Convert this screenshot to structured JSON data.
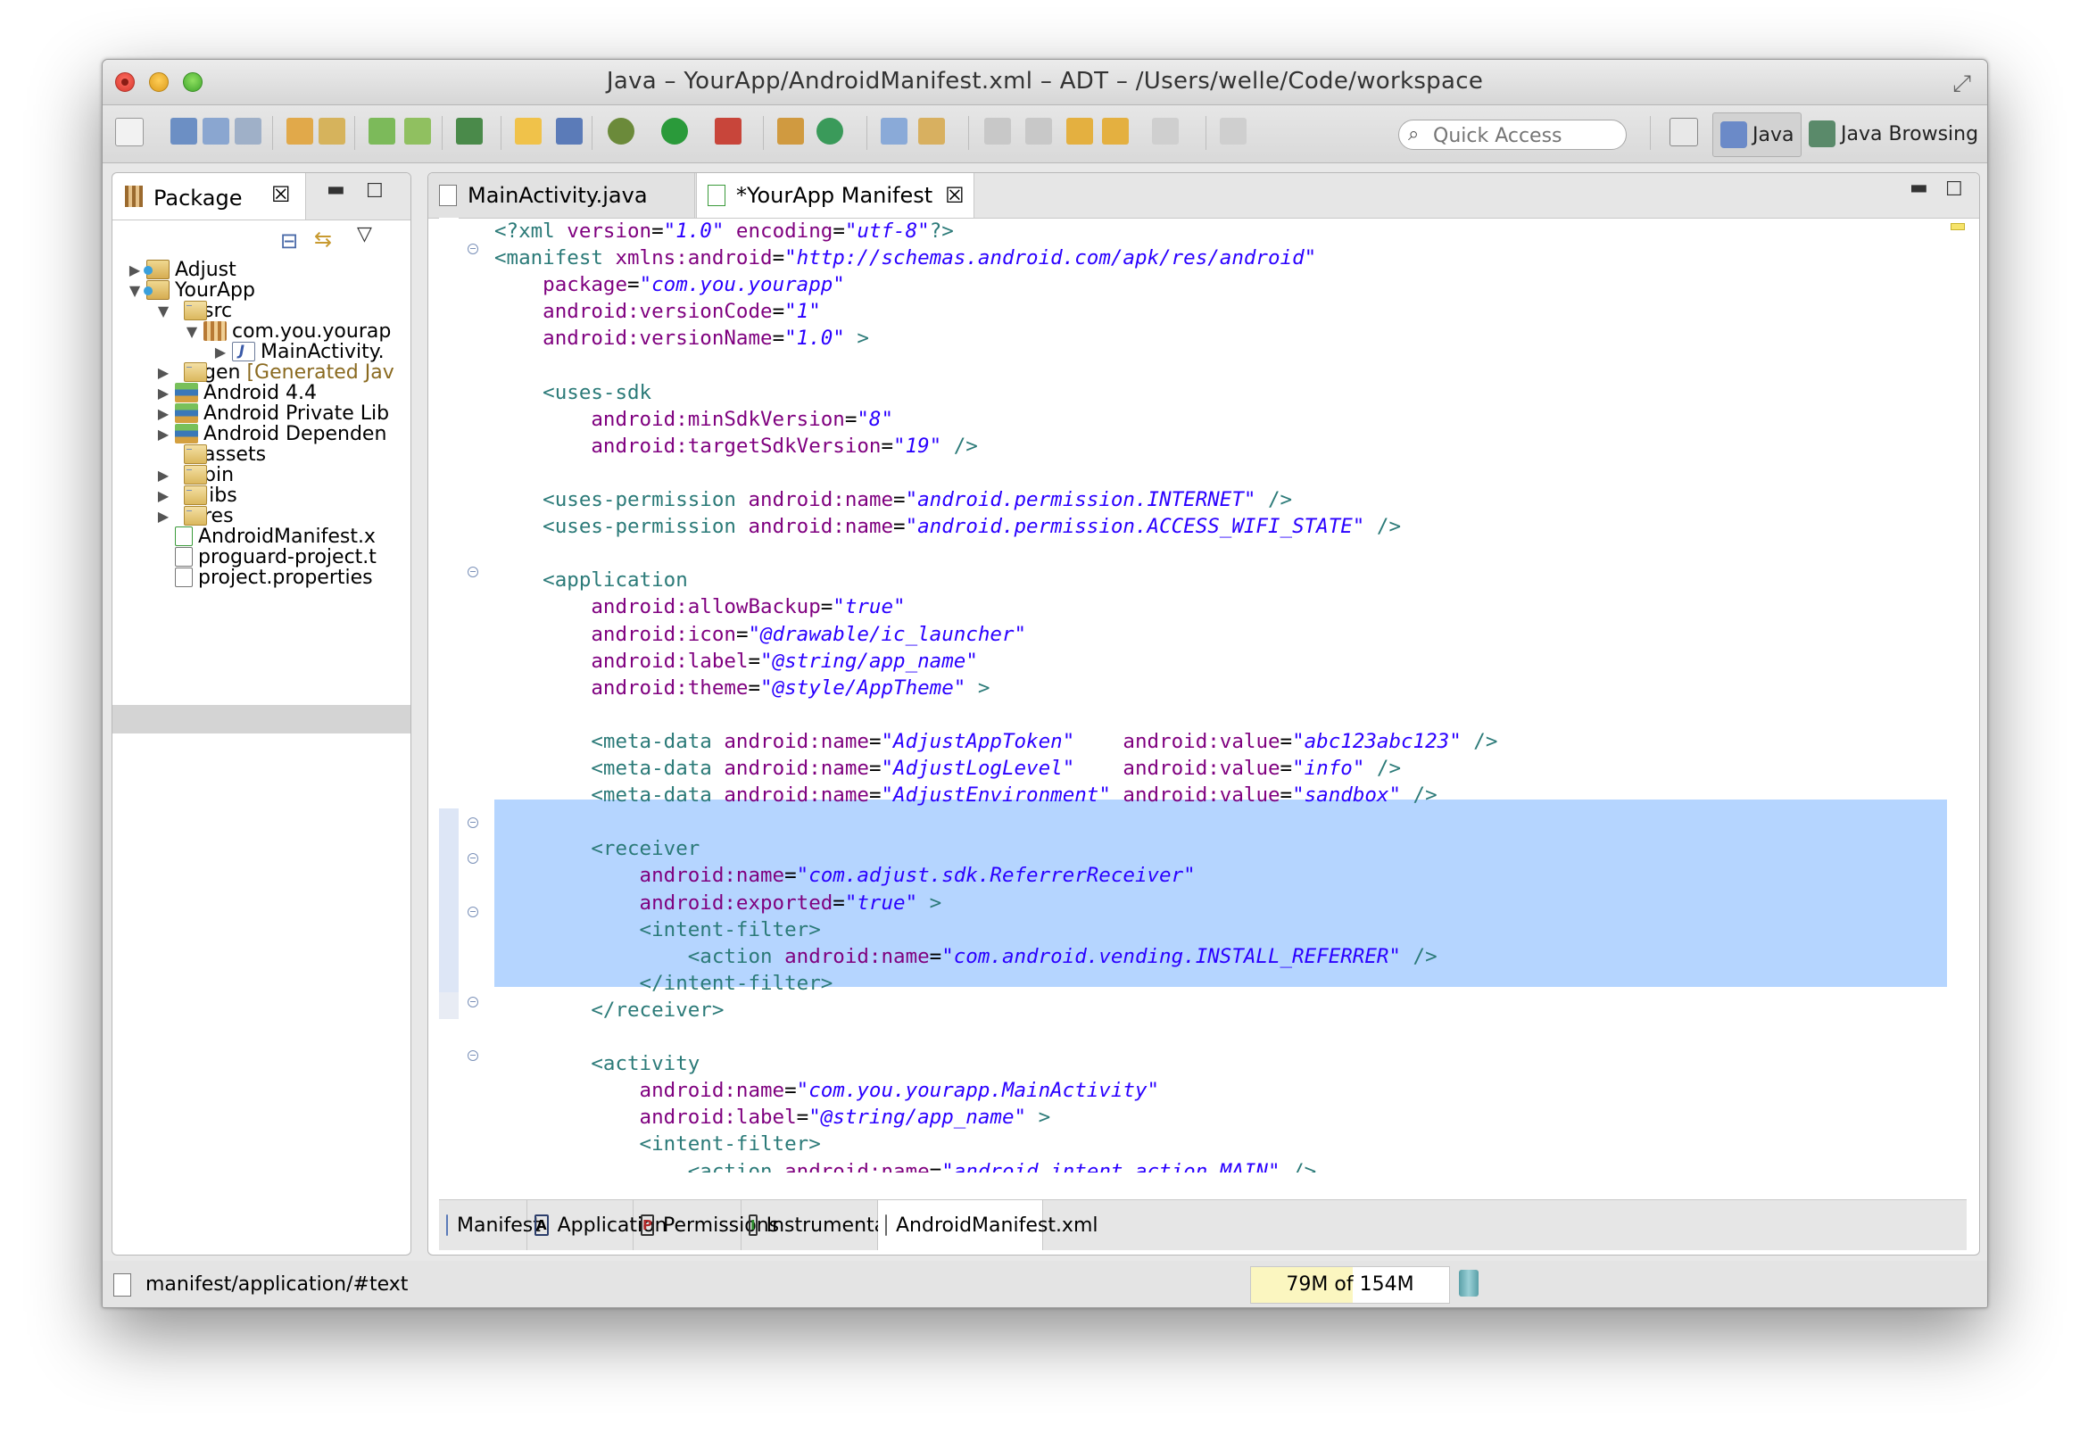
{
  "window": {
    "title": "Java – YourApp/AndroidManifest.xml – ADT – /Users/welle/Code/workspace"
  },
  "toolbar": {
    "quick_access_placeholder": "Quick Access",
    "perspectives": [
      {
        "label": "Java",
        "icon": "java-perspective-icon"
      },
      {
        "label": "Java Browsing",
        "icon": "java-browsing-perspective-icon"
      }
    ]
  },
  "package_explorer": {
    "tab_label": "Package",
    "tree": [
      {
        "label": "Adjust",
        "level": 0,
        "expanded": false,
        "icon": "project-icon"
      },
      {
        "label": "YourApp",
        "level": 0,
        "expanded": true,
        "icon": "project-icon"
      },
      {
        "label": "src",
        "level": 1,
        "expanded": true,
        "icon": "source-folder-icon"
      },
      {
        "label": "com.you.yourap",
        "level": 2,
        "expanded": true,
        "icon": "package-icon"
      },
      {
        "label": "MainActivity.",
        "level": 3,
        "expanded": false,
        "icon": "java-file-icon"
      },
      {
        "label": "gen",
        "suffix": "[Generated Jav",
        "level": 1,
        "expanded": false,
        "icon": "source-folder-icon"
      },
      {
        "label": "Android 4.4",
        "level": 1,
        "expanded": false,
        "icon": "library-icon"
      },
      {
        "label": "Android Private Lib",
        "level": 1,
        "expanded": false,
        "icon": "library-icon"
      },
      {
        "label": "Android Dependen",
        "level": 1,
        "expanded": false,
        "icon": "library-icon"
      },
      {
        "label": "assets",
        "level": 1,
        "expanded": null,
        "icon": "folder-icon"
      },
      {
        "label": "bin",
        "level": 1,
        "expanded": false,
        "icon": "folder-icon"
      },
      {
        "label": "libs",
        "level": 1,
        "expanded": false,
        "icon": "folder-icon"
      },
      {
        "label": "res",
        "level": 1,
        "expanded": false,
        "icon": "folder-icon"
      },
      {
        "label": "AndroidManifest.x",
        "level": 1,
        "expanded": null,
        "icon": "manifest-file-icon",
        "selected": true
      },
      {
        "label": "proguard-project.t",
        "level": 1,
        "expanded": null,
        "icon": "text-file-icon"
      },
      {
        "label": "project.properties",
        "level": 1,
        "expanded": null,
        "icon": "text-file-icon"
      }
    ]
  },
  "editor": {
    "tabs": [
      {
        "label": "MainActivity.java",
        "icon": "java-file-icon",
        "active": false
      },
      {
        "label": "*YourApp Manifest",
        "icon": "manifest-file-icon",
        "active": true
      }
    ],
    "code_lines": [
      [
        [
          "pi",
          "<?xml "
        ],
        [
          "attr",
          "version"
        ],
        [
          "punc",
          "="
        ],
        [
          "val",
          "\"1.0\""
        ],
        [
          "attr",
          " encoding"
        ],
        [
          "punc",
          "="
        ],
        [
          "val",
          "\"utf-8\""
        ],
        [
          "pi",
          "?>"
        ]
      ],
      [
        [
          "tag",
          "<manifest "
        ],
        [
          "attr",
          "xmlns:android"
        ],
        [
          "punc",
          "="
        ],
        [
          "val",
          "\"http://schemas.android.com/apk/res/android\""
        ]
      ],
      [
        [
          "attr",
          "    package"
        ],
        [
          "punc",
          "="
        ],
        [
          "val",
          "\"com.you.yourapp\""
        ]
      ],
      [
        [
          "attr",
          "    android:versionCode"
        ],
        [
          "punc",
          "="
        ],
        [
          "val",
          "\"1\""
        ]
      ],
      [
        [
          "attr",
          "    android:versionName"
        ],
        [
          "punc",
          "="
        ],
        [
          "val",
          "\"1.0\""
        ],
        [
          "tag",
          " >"
        ]
      ],
      [],
      [
        [
          "tag",
          "    <uses-sdk"
        ]
      ],
      [
        [
          "attr",
          "        android:minSdkVersion"
        ],
        [
          "punc",
          "="
        ],
        [
          "val",
          "\"8\""
        ]
      ],
      [
        [
          "attr",
          "        android:targetSdkVersion"
        ],
        [
          "punc",
          "="
        ],
        [
          "val",
          "\"19\""
        ],
        [
          "tag",
          " />"
        ]
      ],
      [],
      [
        [
          "tag",
          "    <uses-permission "
        ],
        [
          "attr",
          "android:name"
        ],
        [
          "punc",
          "="
        ],
        [
          "val",
          "\"android.permission.INTERNET\""
        ],
        [
          "tag",
          " />"
        ]
      ],
      [
        [
          "tag",
          "    <uses-permission "
        ],
        [
          "attr",
          "android:name"
        ],
        [
          "punc",
          "="
        ],
        [
          "val",
          "\"android.permission.ACCESS_WIFI_STATE\""
        ],
        [
          "tag",
          " />"
        ]
      ],
      [],
      [
        [
          "tag",
          "    <application"
        ]
      ],
      [
        [
          "attr",
          "        android:allowBackup"
        ],
        [
          "punc",
          "="
        ],
        [
          "val",
          "\"true\""
        ]
      ],
      [
        [
          "attr",
          "        android:icon"
        ],
        [
          "punc",
          "="
        ],
        [
          "val",
          "\"@drawable/ic_launcher\""
        ]
      ],
      [
        [
          "attr",
          "        android:label"
        ],
        [
          "punc",
          "="
        ],
        [
          "val",
          "\"@string/app_name\""
        ]
      ],
      [
        [
          "attr",
          "        android:theme"
        ],
        [
          "punc",
          "="
        ],
        [
          "val",
          "\"@style/AppTheme\""
        ],
        [
          "tag",
          " >"
        ]
      ],
      [],
      [
        [
          "tag",
          "        <meta-data "
        ],
        [
          "attr",
          "android:name"
        ],
        [
          "punc",
          "="
        ],
        [
          "val",
          "\"AdjustAppToken\""
        ],
        [
          "attr",
          "    android:value"
        ],
        [
          "punc",
          "="
        ],
        [
          "val",
          "\"abc123abc123\""
        ],
        [
          "tag",
          " />"
        ]
      ],
      [
        [
          "tag",
          "        <meta-data "
        ],
        [
          "attr",
          "android:name"
        ],
        [
          "punc",
          "="
        ],
        [
          "val",
          "\"AdjustLogLevel\""
        ],
        [
          "attr",
          "    android:value"
        ],
        [
          "punc",
          "="
        ],
        [
          "val",
          "\"info\""
        ],
        [
          "tag",
          " />"
        ]
      ],
      [
        [
          "tag",
          "        <meta-data "
        ],
        [
          "attr",
          "android:name"
        ],
        [
          "punc",
          "="
        ],
        [
          "val",
          "\"AdjustEnvironment\""
        ],
        [
          "attr",
          " android:value"
        ],
        [
          "punc",
          "="
        ],
        [
          "val",
          "\"sandbox\""
        ],
        [
          "tag",
          " />"
        ]
      ],
      [],
      [
        [
          "tag",
          "        <receiver"
        ]
      ],
      [
        [
          "attr",
          "            android:name"
        ],
        [
          "punc",
          "="
        ],
        [
          "val",
          "\"com.adjust.sdk.ReferrerReceiver\""
        ]
      ],
      [
        [
          "attr",
          "            android:exported"
        ],
        [
          "punc",
          "="
        ],
        [
          "val",
          "\"true\""
        ],
        [
          "tag",
          " >"
        ]
      ],
      [
        [
          "tag",
          "            <intent-filter>"
        ]
      ],
      [
        [
          "tag",
          "                <action "
        ],
        [
          "attr",
          "android:name"
        ],
        [
          "punc",
          "="
        ],
        [
          "val",
          "\"com.android.vending.INSTALL_REFERRER\""
        ],
        [
          "tag",
          " />"
        ]
      ],
      [
        [
          "tag",
          "            </intent-filter>"
        ]
      ],
      [
        [
          "tag",
          "        </receiver>"
        ]
      ],
      [],
      [
        [
          "tag",
          "        <activity"
        ]
      ],
      [
        [
          "attr",
          "            android:name"
        ],
        [
          "punc",
          "="
        ],
        [
          "val",
          "\"com.you.yourapp.MainActivity\""
        ]
      ],
      [
        [
          "attr",
          "            android:label"
        ],
        [
          "punc",
          "="
        ],
        [
          "val",
          "\"@string/app_name\""
        ],
        [
          "tag",
          " >"
        ]
      ],
      [
        [
          "tag",
          "            <intent-filter>"
        ]
      ],
      [
        [
          "tag",
          "                <action "
        ],
        [
          "attr",
          "android:name"
        ],
        [
          "punc",
          "="
        ],
        [
          "val",
          "\"android.intent.action.MAIN\""
        ],
        [
          "tag",
          " />"
        ]
      ]
    ],
    "bottom_tabs": [
      {
        "label": "Manifest",
        "icon": "manifest-overview-icon",
        "letter": "",
        "active": false
      },
      {
        "label": "Application",
        "icon": "application-tab-icon",
        "letter": "A",
        "active": false
      },
      {
        "label": "Permissions",
        "icon": "permissions-tab-icon",
        "letter": "P",
        "active": false
      },
      {
        "label": "Instrumentation",
        "icon": "instrumentation-tab-icon",
        "letter": "I",
        "active": false
      },
      {
        "label": "AndroidManifest.xml",
        "icon": "xml-source-icon",
        "letter": "",
        "active": true
      }
    ]
  },
  "status_bar": {
    "path": "manifest/application/#text",
    "heap": "79M of 154M",
    "heap_used_fraction": 0.513
  }
}
